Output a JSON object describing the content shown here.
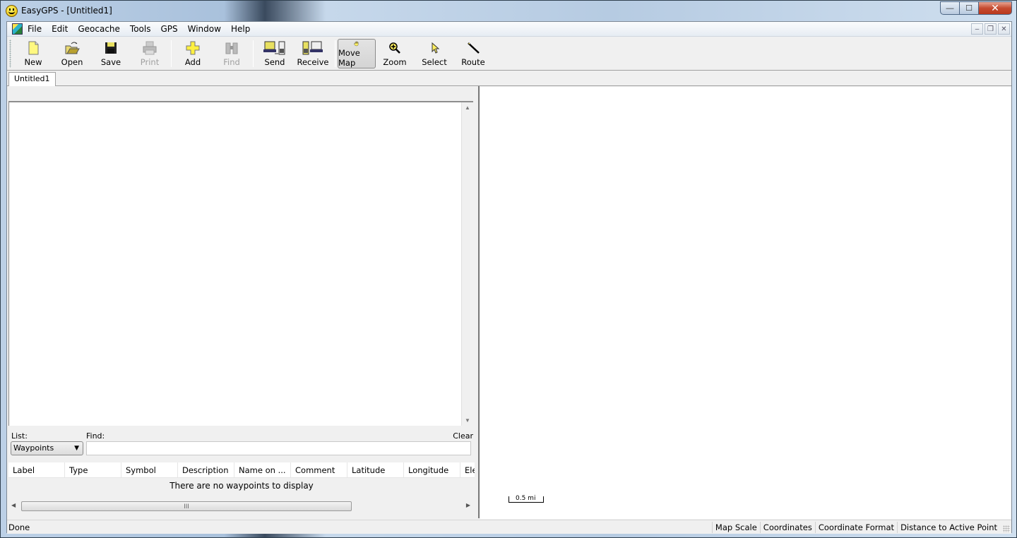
{
  "window": {
    "title": "EasyGPS - [Untitled1]",
    "minimize": "—",
    "maximize": "☐",
    "close": "✕"
  },
  "menubar": {
    "items": [
      "File",
      "Edit",
      "Geocache",
      "Tools",
      "GPS",
      "Window",
      "Help"
    ],
    "mdi": {
      "minimize": "–",
      "restore": "❐",
      "close": "✕"
    }
  },
  "toolbar": {
    "buttons": [
      {
        "label": "New",
        "icon": "new-document-icon",
        "enabled": true
      },
      {
        "label": "Open",
        "icon": "open-folder-icon",
        "enabled": true
      },
      {
        "label": "Save",
        "icon": "floppy-disk-icon",
        "enabled": true
      },
      {
        "label": "Print",
        "icon": "printer-icon",
        "enabled": false
      },
      {
        "label": "Add",
        "icon": "plus-icon",
        "enabled": true
      },
      {
        "label": "Find",
        "icon": "binoculars-icon",
        "enabled": false
      },
      {
        "label": "Send",
        "icon": "send-to-gps-icon",
        "enabled": true
      },
      {
        "label": "Receive",
        "icon": "receive-from-gps-icon",
        "enabled": true
      },
      {
        "label": "Move Map",
        "icon": "hand-icon",
        "enabled": true,
        "pressed": true
      },
      {
        "label": "Zoom",
        "icon": "magnifier-icon",
        "enabled": true
      },
      {
        "label": "Select",
        "icon": "arrow-pointer-icon",
        "enabled": true
      },
      {
        "label": "Route",
        "icon": "route-pencil-icon",
        "enabled": true
      }
    ]
  },
  "tabs": {
    "document": "Untitled1"
  },
  "list_panel": {
    "list_label": "List:",
    "list_value": "Waypoints",
    "find_label": "Find:",
    "find_value": "",
    "clear_label": "Clear",
    "columns": [
      "Label",
      "Type",
      "Symbol",
      "Description",
      "Name on ...",
      "Comment",
      "Latitude",
      "Longitude",
      "Ele"
    ],
    "empty_message": "There are no waypoints to display",
    "hscroll_grip": "III"
  },
  "map": {
    "scale_label": "0.5 mi"
  },
  "statusbar": {
    "status": "Done",
    "panes": [
      "Map Scale",
      "Coordinates",
      "Coordinate Format",
      "Distance to Active Point"
    ]
  }
}
